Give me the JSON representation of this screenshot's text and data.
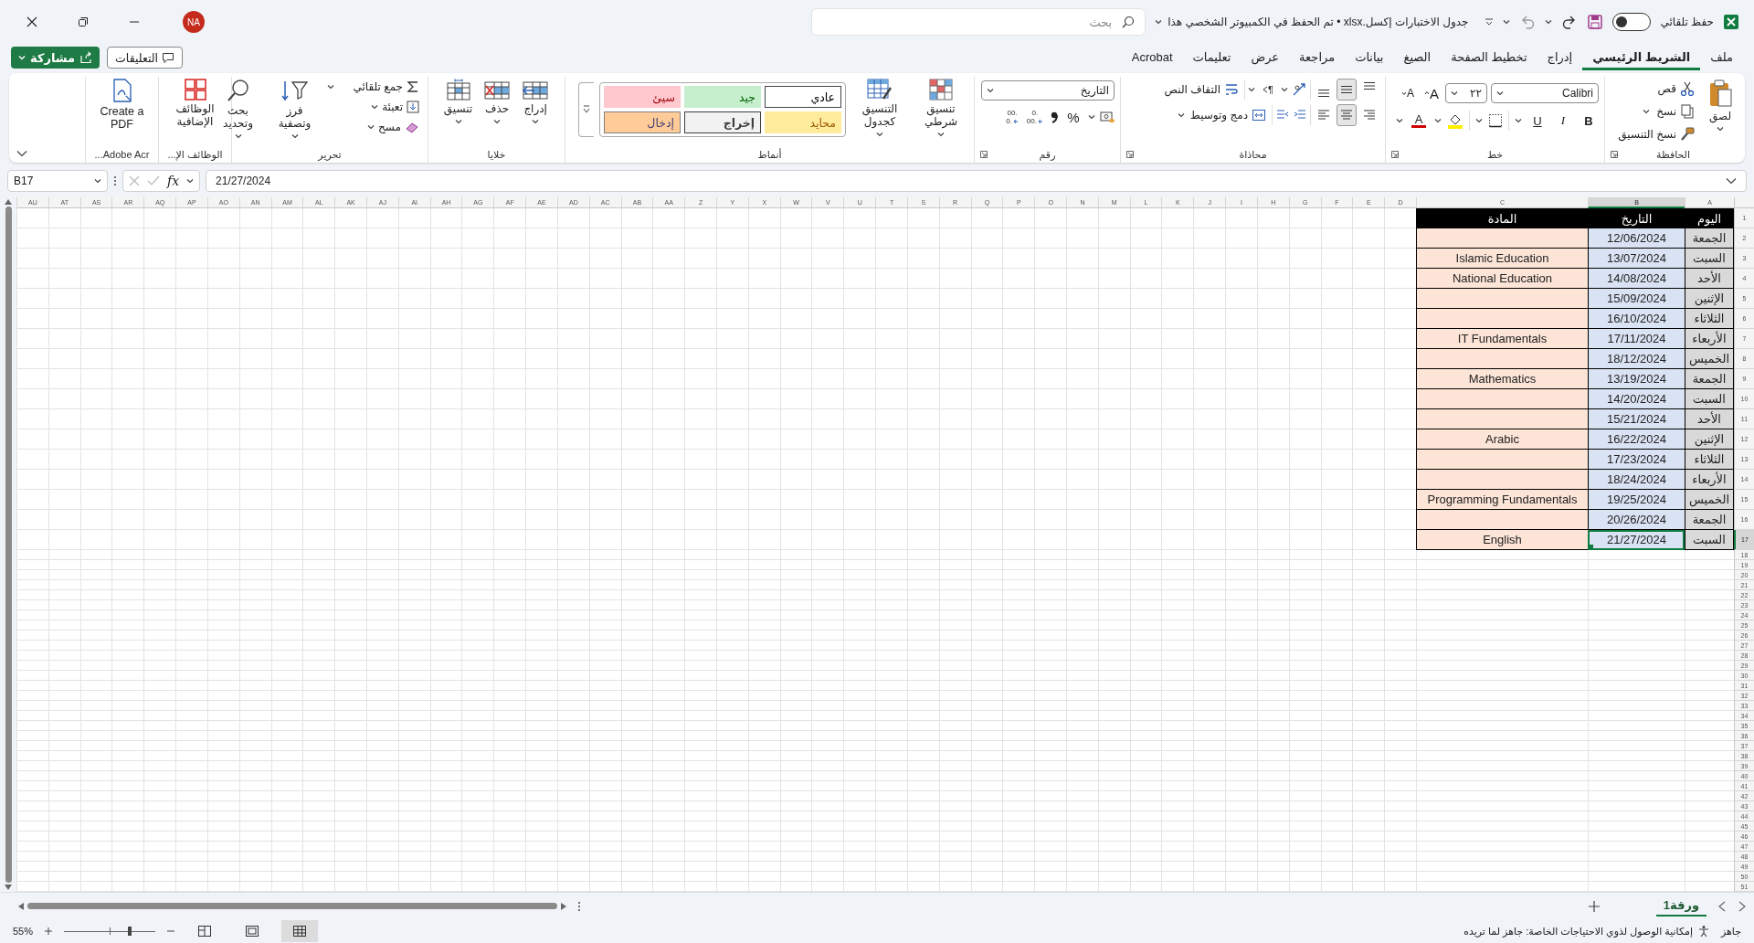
{
  "title_bar": {
    "autosave": {
      "label": "حفظ تلقائي",
      "on": false
    },
    "document_title": "جدول الاختبارات إكسل.xlsx • تم الحفظ في الكمبيوتر الشخصي هذا",
    "search": {
      "placeholder": "بحث"
    },
    "avatar": "NA"
  },
  "menu_tabs": [
    {
      "label": "ملف",
      "selected": false
    },
    {
      "label": "الشريط الرئيسي",
      "selected": true
    },
    {
      "label": "إدراج",
      "selected": false
    },
    {
      "label": "تخطيط الصفحة",
      "selected": false
    },
    {
      "label": "الصيغ",
      "selected": false
    },
    {
      "label": "بيانات",
      "selected": false
    },
    {
      "label": "مراجعة",
      "selected": false
    },
    {
      "label": "عرض",
      "selected": false
    },
    {
      "label": "تعليمات",
      "selected": false
    },
    {
      "label": "Acrobat",
      "selected": false
    }
  ],
  "comments_button": "التعليقات",
  "share_button": "مشاركة",
  "ribbon": [
    {
      "kind": "clipboard",
      "label": "الحافظة",
      "paste": "لصق",
      "cut": "قص",
      "copy": "نسخ",
      "format_painter": "نسخ التنسيق"
    },
    {
      "kind": "font",
      "label": "خط",
      "font_name": "Calibri",
      "font_size": "٢٢",
      "grow": "A",
      "shrink": "A",
      "bold": "B",
      "italic": "I",
      "underline": "U",
      "font_color": "A"
    },
    {
      "kind": "alignment",
      "label": "محاذاة",
      "wrap": "التفاف النص",
      "merge": "دمج وتوسيط",
      "paragraph": "¶",
      "vertical_align": [
        {
          "kind": "top",
          "selected": false
        },
        {
          "kind": "middle",
          "selected": true
        },
        {
          "kind": "bottom",
          "selected": false
        }
      ],
      "horizontal_align": [
        {
          "kind": "right",
          "selected": false
        },
        {
          "kind": "center",
          "selected": true
        },
        {
          "kind": "left",
          "selected": false
        }
      ]
    },
    {
      "kind": "number",
      "label": "رقم",
      "format": "التاريخ",
      "percent": "%",
      "decimals": [
        {
          "top": ".0",
          "bottom": ".00"
        },
        {
          "top": ".00",
          "bottom": ".0"
        }
      ]
    },
    {
      "kind": "styles",
      "label": "أنماط",
      "conditional": "تنسيق شرطي",
      "as_table": "التنسيق كجدول",
      "cell_styles": [
        {
          "name": "عادي",
          "kind": "normal"
        },
        {
          "name": "جيد",
          "kind": "good"
        },
        {
          "name": "سيئ",
          "kind": "bad"
        },
        {
          "name": "محايد",
          "kind": "neutral"
        },
        {
          "name": "إخراج",
          "kind": "output"
        },
        {
          "name": "إدخال",
          "kind": "input"
        }
      ]
    },
    {
      "kind": "cells",
      "label": "خلايا",
      "buttons": [
        {
          "label": "إدراج",
          "kind": "insert"
        },
        {
          "label": "حذف",
          "kind": "delete"
        },
        {
          "label": "تنسيق",
          "kind": "format"
        }
      ]
    },
    {
      "kind": "editing",
      "label": "تحرير",
      "autosum": "جمع تلقائي",
      "fill": "تعبئة",
      "clear": "مسح",
      "sort": "فرز وتصفية",
      "find": "بحث وتحديد"
    },
    {
      "kind": "addins",
      "label": "الوظائف الإ...",
      "button": "الوظائف الإضافية"
    },
    {
      "kind": "acrobat",
      "label": "Adobe Acr...",
      "button": "Create a PDF"
    }
  ],
  "formula_bar": {
    "name_box": "B17",
    "function_label": "fx",
    "value": "21/27/2024"
  },
  "sheet": {
    "column_headers": [
      {
        "label": "A",
        "selected": false
      },
      {
        "label": "B",
        "selected": true
      },
      {
        "label": "C",
        "selected": false
      },
      {
        "label": "D",
        "selected": false
      },
      {
        "label": "E",
        "selected": false
      },
      {
        "label": "F",
        "selected": false
      },
      {
        "label": "G",
        "selected": false
      },
      {
        "label": "H",
        "selected": false
      },
      {
        "label": "I",
        "selected": false
      },
      {
        "label": "J",
        "selected": false
      },
      {
        "label": "K",
        "selected": false
      },
      {
        "label": "L",
        "selected": false
      },
      {
        "label": "M",
        "selected": false
      },
      {
        "label": "N",
        "selected": false
      },
      {
        "label": "O",
        "selected": false
      },
      {
        "label": "P",
        "selected": false
      },
      {
        "label": "Q",
        "selected": false
      },
      {
        "label": "R",
        "selected": false
      },
      {
        "label": "S",
        "selected": false
      },
      {
        "label": "T",
        "selected": false
      },
      {
        "label": "U",
        "selected": false
      },
      {
        "label": "V",
        "selected": false
      },
      {
        "label": "W",
        "selected": false
      },
      {
        "label": "X",
        "selected": false
      },
      {
        "label": "Y",
        "selected": false
      },
      {
        "label": "Z",
        "selected": false
      },
      {
        "label": "AA",
        "selected": false
      },
      {
        "label": "AB",
        "selected": false
      },
      {
        "label": "AC",
        "selected": false
      },
      {
        "label": "AD",
        "selected": false
      },
      {
        "label": "AE",
        "selected": false
      },
      {
        "label": "AF",
        "selected": false
      },
      {
        "label": "AG",
        "selected": false
      },
      {
        "label": "AH",
        "selected": false
      },
      {
        "label": "AI",
        "selected": false
      },
      {
        "label": "AJ",
        "selected": false
      },
      {
        "label": "AK",
        "selected": false
      },
      {
        "label": "AL",
        "selected": false
      },
      {
        "label": "AM",
        "selected": false
      },
      {
        "label": "AN",
        "selected": false
      },
      {
        "label": "AO",
        "selected": false
      },
      {
        "label": "AP",
        "selected": false
      },
      {
        "label": "AQ",
        "selected": false
      },
      {
        "label": "AR",
        "selected": false
      },
      {
        "label": "AS",
        "selected": false
      },
      {
        "label": "AT",
        "selected": false
      },
      {
        "label": "AU",
        "selected": false
      }
    ],
    "row_headers": [
      "1",
      "2",
      "3",
      "4",
      "5",
      "6",
      "7",
      "8",
      "9",
      "10",
      "11",
      "12",
      "13",
      "14",
      "15",
      "16",
      "17",
      "18",
      "19",
      "20",
      "21",
      "22",
      "23",
      "24",
      "25",
      "26",
      "27",
      "28",
      "29",
      "30",
      "31",
      "32",
      "33",
      "34",
      "35",
      "36",
      "37",
      "38",
      "39",
      "40",
      "41",
      "42",
      "43",
      "44",
      "45",
      "46",
      "47",
      "48",
      "49",
      "50",
      "51"
    ],
    "table": {
      "headings": [
        "اليوم",
        "التاريخ",
        "المادة"
      ],
      "rows": [
        {
          "day": "الجمعة",
          "date": "12/06/2024",
          "selected": false
        },
        {
          "day": "السبت",
          "date": "13/07/2024",
          "subject": "Islamic Education",
          "selected": false
        },
        {
          "day": "الأحد",
          "date": "14/08/2024",
          "subject": "National Education",
          "selected": false
        },
        {
          "day": "الإثنين",
          "date": "15/09/2024",
          "selected": false
        },
        {
          "day": "الثلاثاء",
          "date": "16/10/2024",
          "selected": false
        },
        {
          "day": "الأربعاء",
          "date": "17/11/2024",
          "subject": "IT Fundamentals",
          "selected": false
        },
        {
          "day": "الخميس",
          "date": "18/12/2024",
          "selected": false
        },
        {
          "day": "الجمعة",
          "date": "13/19/2024",
          "subject": "Mathematics",
          "selected": false
        },
        {
          "day": "السبت",
          "date": "14/20/2024",
          "selected": false
        },
        {
          "day": "الأحد",
          "date": "15/21/2024",
          "selected": false
        },
        {
          "day": "الإثنين",
          "date": "16/22/2024",
          "subject": "Arabic",
          "selected": false
        },
        {
          "day": "الثلاثاء",
          "date": "17/23/2024",
          "selected": false
        },
        {
          "day": "الأربعاء",
          "date": "18/24/2024",
          "selected": false
        },
        {
          "day": "الخميس",
          "date": "19/25/2024",
          "subject": "Programming Fundamentals",
          "selected": false
        },
        {
          "day": "الجمعة",
          "date": "20/26/2024",
          "selected": false
        },
        {
          "day": "السبت",
          "date": "21/27/2024",
          "subject": "English",
          "selected": true
        }
      ]
    }
  },
  "sheet_tabs": [
    {
      "label": "ورقة1",
      "selected": true
    }
  ],
  "status_bar": {
    "ready": "جاهز",
    "accessibility": "إمكانية الوصول لذوي الاحتياجات الخاصة: جاهز لما تريده",
    "views": [
      {
        "kind": "normal",
        "selected": true
      },
      {
        "kind": "page_layout",
        "selected": false
      },
      {
        "kind": "page_break",
        "selected": false
      }
    ],
    "zoom": {
      "label": "55%",
      "level": 0.72
    }
  }
}
